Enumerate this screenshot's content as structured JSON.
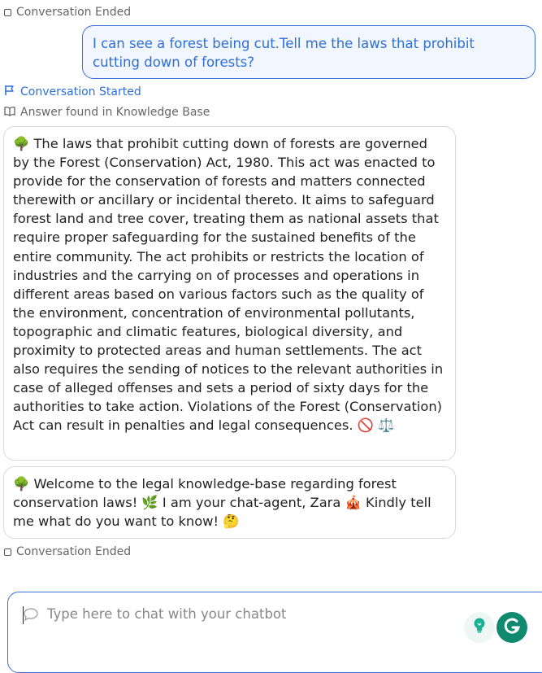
{
  "status_top": "Conversation Ended",
  "user_message": "I can see a forest being cut.Tell me the laws that prohibit cutting down of forests?",
  "status_started": "Conversation Started",
  "status_kb": "Answer found in Knowledge Base",
  "bot_answer": {
    "emoji_lead": "🌳",
    "text": "The laws that prohibit cutting down of forests are governed by the Forest (Conservation) Act, 1980. This act was enacted to provide for the conservation of forests and matters connected therewith or ancillary or incidental thereto. It aims to safeguard forest land and tree cover, treating them as national assets that require proper safeguarding for the sustained benefits of the entire community. The act prohibits or restricts the location of industries and the carrying on of processes and operations in different areas based on various factors such as the quality of the environment, concentration of environmental pollutants, topographic and climatic features, biological diversity, and proximity to protected areas and human settlements. The act also requires the sending of notices to the relevant authorities in case of alleged offenses and sets a period of sixty days for the authorities to take action. Violations of the Forest (Conservation) Act can result in penalties and legal consequences.",
    "emoji_tail": "🚫 ⚖️"
  },
  "bot_welcome": {
    "emoji_lead": "🌳",
    "part1": "Welcome to the legal knowledge-base regarding forest conservation laws!",
    "emoji1": "🌿",
    "part2": "I am your chat-agent, Zara",
    "emoji2": "🎪",
    "part3": "Kindly tell me what do you want to know!",
    "emoji3": "🤔"
  },
  "status_bottom": "Conversation Ended",
  "composer": {
    "placeholder": "Type here to chat with your chatbot",
    "value": ""
  },
  "icons": {
    "ended": "stop-square-icon",
    "started": "flag-icon",
    "kb": "book-icon",
    "chat": "chat-bubble-icon",
    "bulb": "lightbulb-icon",
    "grammarly": "grammarly-g-icon"
  },
  "colors": {
    "accent": "#3d6fd8",
    "user_text": "#2f6fd6",
    "grammarly": "#0f8a6e"
  }
}
